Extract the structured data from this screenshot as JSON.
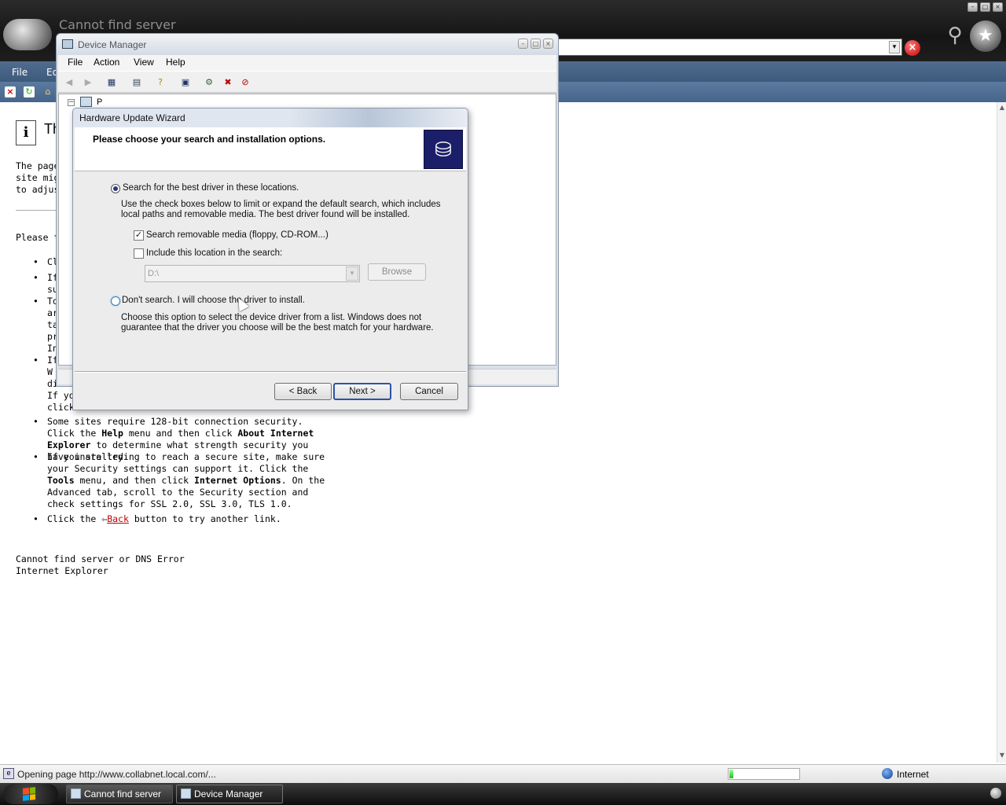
{
  "ie": {
    "title": "Cannot find server",
    "menu": [
      "File",
      "Ed"
    ],
    "page": {
      "heading": "Th",
      "para_lines": "The page\nsite migh\nto adjust",
      "please_try": "Please tr",
      "tips": {
        "t1": "Cl",
        "t2": "If\nsu",
        "t3": "To\nar\nta\npr\nIn",
        "t4": "If\nW\ndi\nIf you\nclick",
        "t5a": "Some sites require 128-bit connection security. Click the ",
        "t5b": "Help",
        "t5c": " menu and then click ",
        "t5d": "About Internet Explorer",
        "t5e": " to determine what strength security you have installed.",
        "t6a": "If you are trying to reach a secure site, make sure your Security settings can support it. Click the ",
        "t6b": "Tools",
        "t6c": " menu, and then click ",
        "t6d": "Internet Options",
        "t6e": ". On the Advanced tab, scroll to the Security section and check settings for SSL 2.0, SSL 3.0, TLS 1.0.",
        "t7a": "Click the ",
        "t7b": "Back",
        "t7c": " button to try another link."
      },
      "footer_line1": "Cannot find server or DNS Error",
      "footer_line2": "Internet Explorer"
    },
    "status": {
      "text": "Opening page http://www.collabnet.local.com/...",
      "progress": 0.05,
      "zone": "Internet"
    }
  },
  "device_manager": {
    "title": "Device Manager",
    "menu": [
      "File",
      "Action",
      "View",
      "Help"
    ],
    "tree_root_label": "P"
  },
  "wizard": {
    "title": "Hardware Update Wizard",
    "heading": "Please choose your search and installation options.",
    "option_search_label": "Search for the best driver in these locations.",
    "option_search_desc": "Use the check boxes below to limit or expand the default search, which includes local paths and removable media. The best driver found will be installed.",
    "check_removable_label": "Search removable media (floppy, CD-ROM...)",
    "check_removable_checked": true,
    "check_location_label": "Include this location in the search:",
    "check_location_checked": false,
    "location_path": "D:\\",
    "browse_label": "Browse",
    "option_dont_search_label": "Don't search. I will choose the driver to install.",
    "option_dont_search_desc": "Choose this option to select the device driver from a list.  Windows does not guarantee that the driver you choose will be the best match for your hardware.",
    "back_label": "< Back",
    "next_label": "Next >",
    "cancel_label": "Cancel"
  },
  "taskbar": {
    "items": [
      "Cannot find server",
      "Device Manager"
    ]
  }
}
